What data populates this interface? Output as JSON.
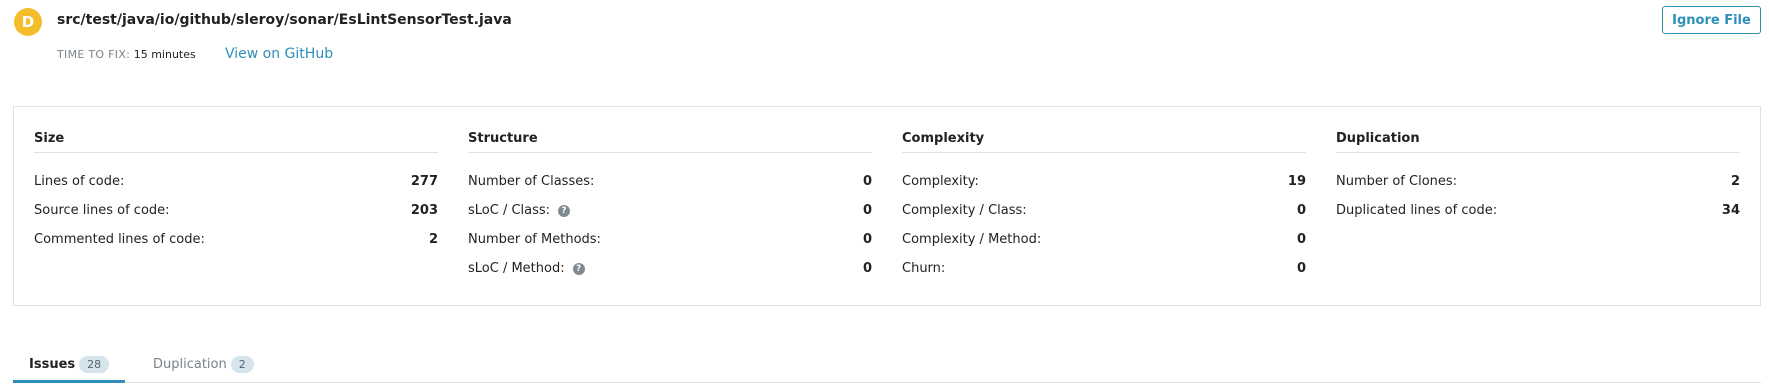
{
  "header": {
    "grade": "D",
    "file_path": "src/test/java/io/github/sleroy/sonar/EsLintSensorTest.java",
    "time_to_fix_label": "TIME TO FIX:",
    "time_to_fix_value": "15 minutes",
    "github_link": "View on GitHub",
    "ignore_button": "Ignore File",
    "grade_color": "#f4bd2b",
    "accent_color": "#2e8fb8"
  },
  "metrics": {
    "size": {
      "title": "Size",
      "rows": [
        {
          "label": "Lines of code:",
          "value": "277"
        },
        {
          "label": "Source lines of code:",
          "value": "203"
        },
        {
          "label": "Commented lines of code:",
          "value": "2"
        }
      ]
    },
    "structure": {
      "title": "Structure",
      "rows": [
        {
          "label": "Number of Classes:",
          "value": "0"
        },
        {
          "label": "sLoC / Class:",
          "value": "0"
        },
        {
          "label": "Number of Methods:",
          "value": "0"
        },
        {
          "label": "sLoC / Method:",
          "value": "0"
        }
      ]
    },
    "complexity": {
      "title": "Complexity",
      "rows": [
        {
          "label": "Complexity:",
          "value": "19"
        },
        {
          "label": "Complexity / Class:",
          "value": "0"
        },
        {
          "label": "Complexity / Method:",
          "value": "0"
        },
        {
          "label": "Churn:",
          "value": "0"
        }
      ]
    },
    "duplication": {
      "title": "Duplication",
      "rows": [
        {
          "label": "Number of Clones:",
          "value": "2"
        },
        {
          "label": "Duplicated lines of code:",
          "value": "34"
        }
      ]
    }
  },
  "tabs": [
    {
      "label": "Issues",
      "count": "28"
    },
    {
      "label": "Duplication",
      "count": "2"
    }
  ]
}
